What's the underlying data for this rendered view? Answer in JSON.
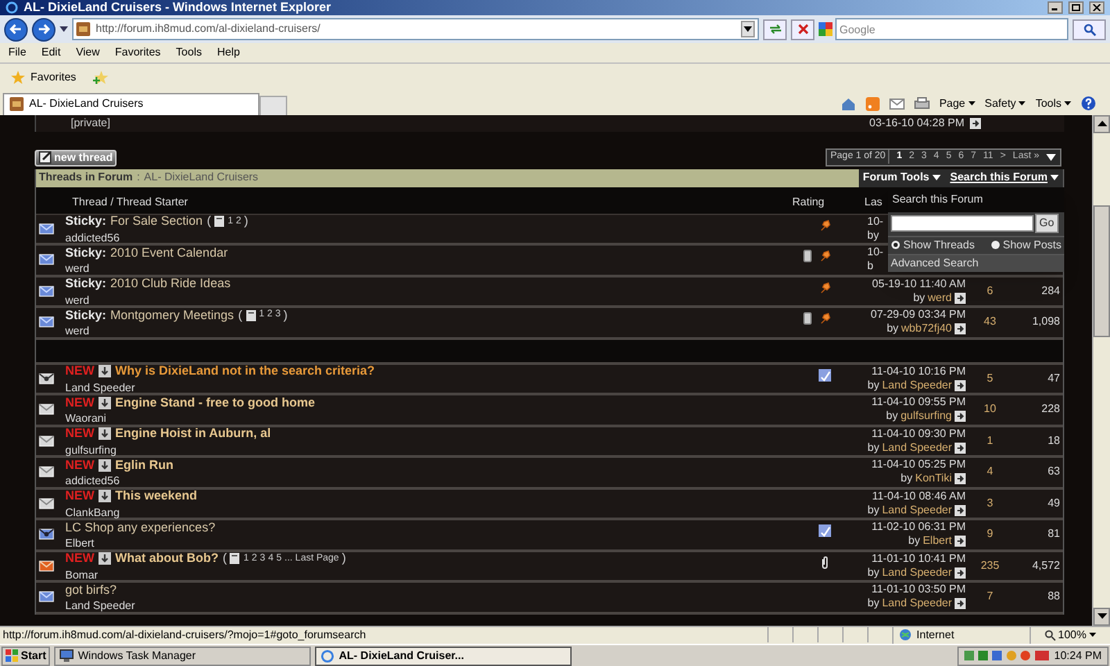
{
  "window": {
    "title": "AL- DixieLand Cruisers - Windows Internet Explorer"
  },
  "address_bar": {
    "url": "http://forum.ih8mud.com/al-dixieland-cruisers/"
  },
  "search": {
    "placeholder": "Google"
  },
  "menu": [
    "File",
    "Edit",
    "View",
    "Favorites",
    "Tools",
    "Help"
  ],
  "favorites": {
    "label": "Favorites"
  },
  "tabs": [
    {
      "label": "AL- DixieLand Cruisers",
      "selected": true
    }
  ],
  "command_bar": [
    "Page",
    "Safety",
    "Tools"
  ],
  "forum": {
    "previous_row": {
      "title": "[private]",
      "date": "03-16-10 04:28 PM"
    },
    "new_thread": "new thread",
    "pagination": {
      "info": "Page 1 of 20",
      "pages": [
        {
          "label": "1",
          "selected": true
        },
        {
          "label": "2",
          "selected": false
        },
        {
          "label": "3",
          "selected": false
        },
        {
          "label": "4",
          "selected": false
        },
        {
          "label": "5",
          "selected": false
        },
        {
          "label": "6",
          "selected": false
        },
        {
          "label": "7",
          "selected": false
        },
        {
          "label": "11",
          "selected": false
        },
        {
          "label": ">",
          "selected": false
        },
        {
          "label": "Last »",
          "selected": false
        }
      ]
    },
    "header": {
      "label": "Threads in Forum",
      "separator": ":",
      "forum": "AL- DixieLand Cruisers",
      "tools": [
        "Forum Tools",
        "Search this Forum"
      ]
    },
    "columns": [
      "Thread / Thread Starter",
      "Rating",
      "Las"
    ],
    "sticky_rows": [
      {
        "kind": "blue",
        "prefix": "Sticky:",
        "title": "For Sale Section",
        "pages": {
          "open": "(",
          "links": [
            "1",
            "2"
          ],
          "close": ")"
        },
        "starter": "addicted56",
        "pinned": true,
        "clipboard": false,
        "last_post": {
          "cut": true,
          "date": "10-",
          "by": "by"
        }
      },
      {
        "kind": "blue",
        "prefix": "Sticky:",
        "title": "2010 Event Calendar",
        "starter": "werd",
        "pinned": true,
        "clipboard": true,
        "last_post": {
          "cut": true,
          "date": "10-",
          "by": "b"
        }
      },
      {
        "kind": "blue",
        "prefix": "Sticky:",
        "title": "2010 Club Ride Ideas",
        "starter": "werd",
        "pinned": true,
        "clipboard": false,
        "last_post": {
          "cut": false,
          "date": "05-19-10 11:40 AM",
          "by": "by",
          "user": "werd"
        },
        "replies": "6",
        "views": "284"
      },
      {
        "kind": "blue",
        "prefix": "Sticky:",
        "title": "Montgomery Meetings",
        "pages": {
          "open": "(",
          "links": [
            "1",
            "2",
            "3"
          ],
          "close": ")"
        },
        "starter": "werd",
        "pinned": true,
        "clipboard": true,
        "last_post": {
          "cut": false,
          "date": "07-29-09 03:34 PM",
          "by": "by",
          "user": "wbb72fj40"
        },
        "replies": "43",
        "views": "1,098"
      }
    ],
    "rows": [
      {
        "kind": "dot",
        "title": "Why is DixieLand not in the search criteria?",
        "new": true,
        "new_label": "NEW",
        "unread": true,
        "highlighted": true,
        "starter": "Land Speeder",
        "poll": true,
        "attachment": false,
        "last_post": {
          "cut": false,
          "date": "11-04-10 10:16 PM",
          "by": "by",
          "user": "Land Speeder"
        },
        "replies": "5",
        "views": "47"
      },
      {
        "kind": "white",
        "title": "Engine Stand - free to good home",
        "new": true,
        "new_label": "NEW",
        "unread": true,
        "highlighted": false,
        "starter": "Waorani",
        "poll": false,
        "attachment": false,
        "last_post": {
          "cut": false,
          "date": "11-04-10 09:55 PM",
          "by": "by",
          "user": "gulfsurfing"
        },
        "replies": "10",
        "views": "228"
      },
      {
        "kind": "white",
        "title": "Engine Hoist in Auburn, al",
        "new": true,
        "new_label": "NEW",
        "unread": true,
        "highlighted": false,
        "starter": "gulfsurfing",
        "poll": false,
        "attachment": false,
        "last_post": {
          "cut": false,
          "date": "11-04-10 09:30 PM",
          "by": "by",
          "user": "Land Speeder"
        },
        "replies": "1",
        "views": "18"
      },
      {
        "kind": "white",
        "title": "Eglin Run",
        "new": true,
        "new_label": "NEW",
        "unread": true,
        "highlighted": false,
        "starter": "addicted56",
        "poll": false,
        "attachment": false,
        "last_post": {
          "cut": false,
          "date": "11-04-10 05:25 PM",
          "by": "by",
          "user": "KonTiki"
        },
        "replies": "4",
        "views": "63"
      },
      {
        "kind": "white",
        "title": "This weekend",
        "new": true,
        "new_label": "NEW",
        "unread": true,
        "highlighted": false,
        "starter": "ClankBang",
        "poll": false,
        "attachment": false,
        "last_post": {
          "cut": false,
          "date": "11-04-10 08:46 AM",
          "by": "by",
          "user": "Land Speeder"
        },
        "replies": "3",
        "views": "49"
      },
      {
        "kind": "dotblue",
        "title": "LC Shop any experiences?",
        "new": false,
        "unread": false,
        "highlighted": false,
        "starter": "Elbert",
        "poll": true,
        "attachment": false,
        "last_post": {
          "cut": false,
          "date": "11-02-10 06:31 PM",
          "by": "by",
          "user": "Elbert"
        },
        "replies": "9",
        "views": "81"
      },
      {
        "kind": "hot",
        "title": "What about Bob?",
        "new": true,
        "new_label": "NEW",
        "unread": true,
        "highlighted": false,
        "pages": {
          "open": "(",
          "links": [
            "1",
            "2",
            "3",
            "4",
            "5",
            "... Last Page"
          ],
          "close": ")"
        },
        "starter": "Bomar",
        "poll": false,
        "attachment": true,
        "last_post": {
          "cut": false,
          "date": "11-01-10 10:41 PM",
          "by": "by",
          "user": "Land Speeder"
        },
        "replies": "235",
        "views": "4,572"
      },
      {
        "kind": "blue",
        "title": "got birfs?",
        "new": false,
        "unread": false,
        "highlighted": false,
        "starter": "Land Speeder",
        "poll": false,
        "attachment": false,
        "last_post": {
          "cut": false,
          "date": "11-01-10 03:50 PM",
          "by": "by",
          "user": "Land Speeder"
        },
        "replies": "7",
        "views": "88"
      }
    ],
    "search_menu": {
      "title": "Search this Forum",
      "button": "Go",
      "options": [
        {
          "label": "Show Threads",
          "selected": true
        },
        {
          "label": "Show Posts",
          "selected": false
        }
      ],
      "advanced": "Advanced Search"
    }
  },
  "status_bar": {
    "url": "http://forum.ih8mud.com/al-dixieland-cruisers/?mojo=1#goto_forumsearch",
    "zone": "Internet",
    "zoom": "100%"
  },
  "taskbar": {
    "start": "Start",
    "tasks": [
      {
        "label": "Windows Task Manager",
        "selected": false
      },
      {
        "label": "AL- DixieLand Cruiser...",
        "selected": true
      }
    ],
    "clock": "10:24 PM"
  }
}
